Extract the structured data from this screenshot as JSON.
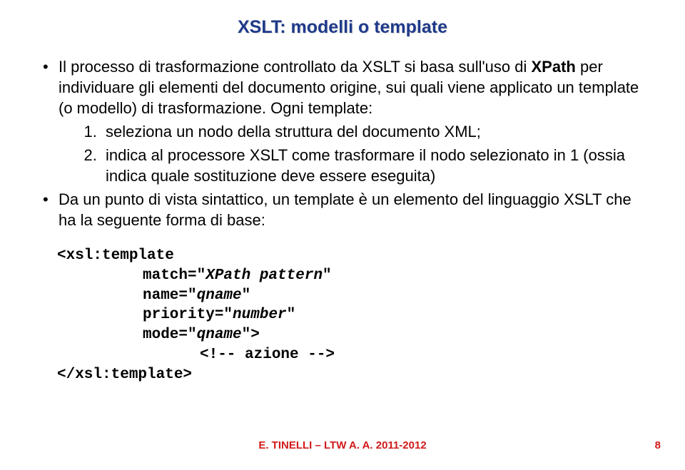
{
  "title": "XSLT: modelli o template",
  "bullets": {
    "b1_pre": "Il processo di trasformazione controllato da XSLT si basa sull'uso di ",
    "b1_bold": "XPath",
    "b1_post": " per individuare gli elementi del documento origine, sui quali viene applicato un template (o modello) di trasformazione. Ogni template:",
    "ol1": "seleziona un nodo della struttura del documento XML;",
    "ol2": "indica al processore XSLT come trasformare il nodo selezionato in 1 (ossia indica quale sostituzione deve essere eseguita)",
    "b2": "Da un punto di vista sintattico, un template è un elemento del linguaggio XSLT che ha la seguente forma di base:"
  },
  "code": {
    "l1": "<xsl:template",
    "l2a": "match=\"",
    "l2b": "XPath pattern",
    "l2c": "\"",
    "l3a": "name=\"",
    "l3b": "qname",
    "l3c": "\"",
    "l4a": "priority=\"",
    "l4b": "number",
    "l4c": "\"",
    "l5a": "mode=\"",
    "l5b": "qname",
    "l5c": "\">",
    "l6": "<!-- azione -->",
    "l7": "</xsl:template>"
  },
  "footer": "E. TINELLI – LTW  A. A. 2011-2012",
  "page": "8"
}
